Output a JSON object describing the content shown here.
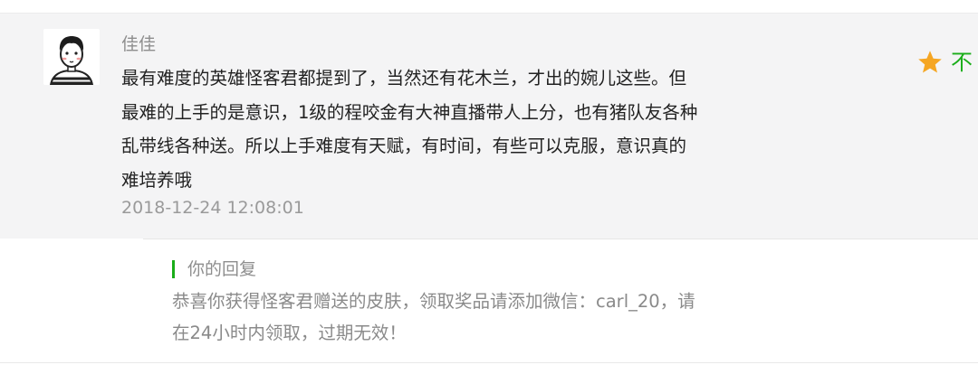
{
  "comment": {
    "author": "佳佳",
    "avatar_icon": "cartoon-boy-avatar-icon",
    "lines": [
      "最有难度的英雄怪客君都提到了，当然还有花木兰，才出的婉儿这些。但",
      "最难的上手的是意识，1级的程咬金有大神直播带人上分，也有猪队友各种",
      "乱带线各种送。所以上手难度有天赋，有时间，有些可以克服，意识真的",
      "难培养哦"
    ],
    "timestamp": "2018-12-24 12:08:01",
    "like": {
      "icon": "star-icon",
      "text": "不",
      "star_color": "#f5a623",
      "text_color": "#1aad19"
    }
  },
  "reply": {
    "label": "你的回复",
    "accent_color": "#1aad19",
    "lines": [
      "恭喜你获得怪客君赠送的皮肤，领取奖品请添加微信：carl_20，请",
      "在24小时内领取，过期无效！"
    ]
  }
}
